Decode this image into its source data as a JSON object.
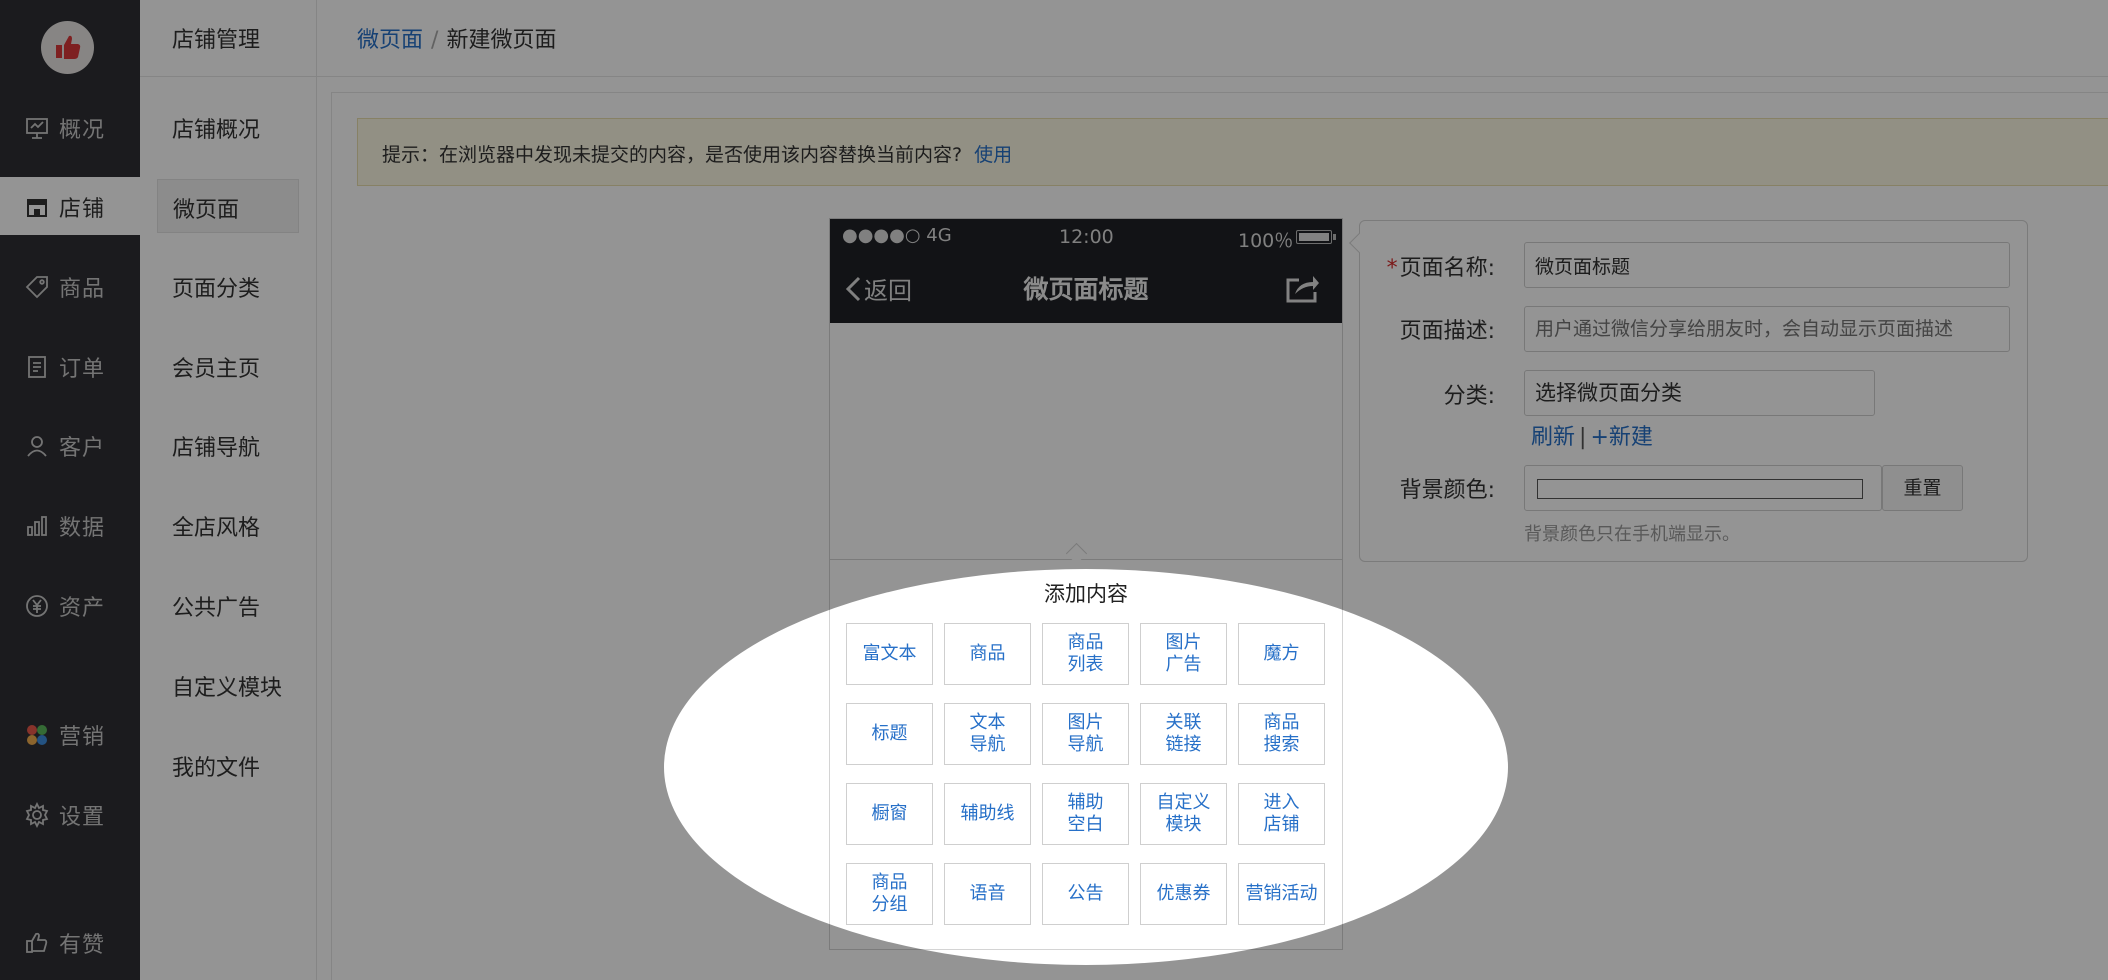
{
  "nav": {
    "items": [
      {
        "label": "概况",
        "icon": "dashboard-icon"
      },
      {
        "label": "店铺",
        "icon": "store-icon"
      },
      {
        "label": "商品",
        "icon": "tag-icon"
      },
      {
        "label": "订单",
        "icon": "order-icon"
      },
      {
        "label": "客户",
        "icon": "user-icon"
      },
      {
        "label": "数据",
        "icon": "chart-icon"
      },
      {
        "label": "资产",
        "icon": "yuan-icon"
      },
      {
        "label": "营销",
        "icon": "marketing-icon"
      },
      {
        "label": "设置",
        "icon": "gear-icon"
      }
    ],
    "footer": "有赞"
  },
  "subnav": {
    "title": "店铺管理",
    "items": [
      "店铺概况",
      "微页面",
      "页面分类",
      "会员主页",
      "店铺导航",
      "全店风格",
      "公共广告",
      "自定义模块",
      "我的文件"
    ]
  },
  "breadcrumb": {
    "parent": "微页面",
    "sep": "/",
    "current": "新建微页面"
  },
  "notice": {
    "text": "提示：在浏览器中发现未提交的内容，是否使用该内容替换当前内容?",
    "action": "使用"
  },
  "phone": {
    "signal": "●●●●○ 4G",
    "time": "12:00",
    "battery": "100％",
    "back": "返回",
    "title": "微页面标题",
    "add_title": "添加内容",
    "tiles": [
      "富文本",
      "商品",
      "商品\n列表",
      "图片\n广告",
      "魔方",
      "标题",
      "文本\n导航",
      "图片\n导航",
      "关联\n链接",
      "商品\n搜索",
      "橱窗",
      "辅助线",
      "辅助\n空白",
      "自定义\n模块",
      "进入\n店铺",
      "商品\n分组",
      "语音",
      "公告",
      "优惠券",
      "营销活动"
    ]
  },
  "form": {
    "required_mark": "*",
    "name_label": "页面名称:",
    "name_value": "微页面标题",
    "desc_label": "页面描述:",
    "desc_placeholder": "用户通过微信分享给朋友时，会自动显示页面描述",
    "category_label": "分类:",
    "category_value": "选择微页面分类",
    "refresh": "刷新",
    "link_sep": "|",
    "new": "+新建",
    "bg_label": "背景颜色:",
    "reset": "重置",
    "bg_help": "背景颜色只在手机端显示。"
  },
  "colors": {
    "accent": "#2770c8",
    "nav_bg": "#2f3035",
    "notice_bg": "#fcf8e3",
    "required": "#d42b2b"
  }
}
